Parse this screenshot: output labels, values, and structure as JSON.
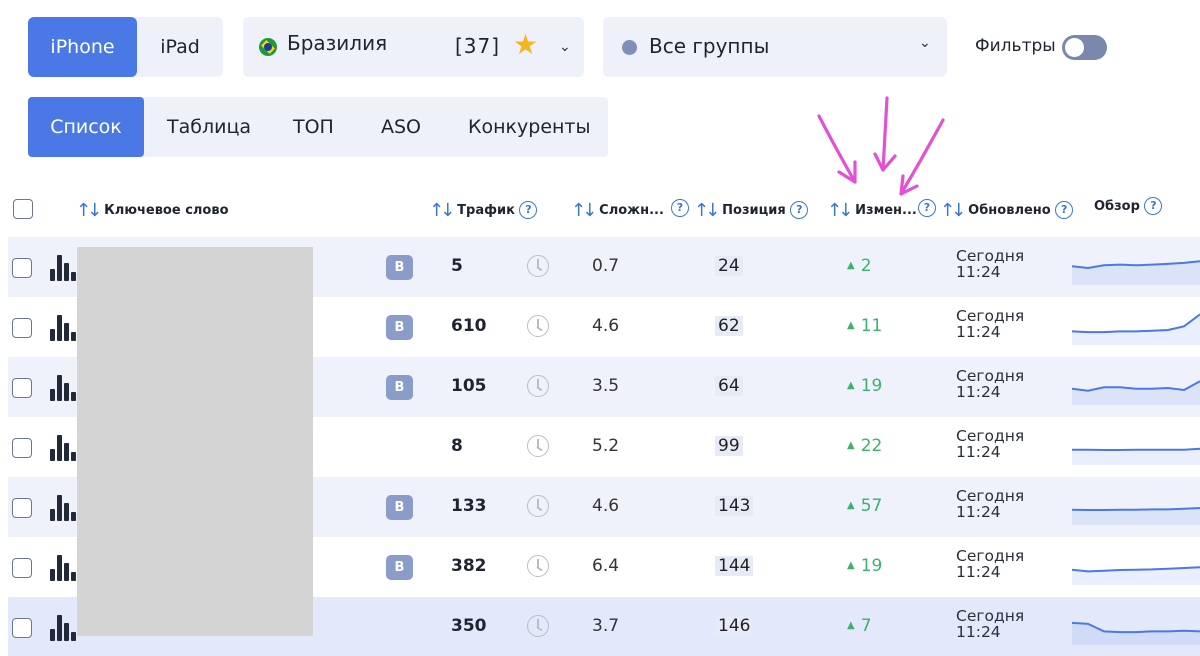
{
  "device_tabs": {
    "iphone": "iPhone",
    "ipad": "iPad",
    "active": "iPhone"
  },
  "country": {
    "name": "Бразилия",
    "count": "[37]"
  },
  "groups": {
    "label": "Все группы"
  },
  "filters": {
    "label": "Фильтры",
    "enabled": false
  },
  "view_tabs": [
    "Список",
    "Таблица",
    "ТОП",
    "ASO",
    "Конкуренты"
  ],
  "view_tab_active": "Список",
  "columns": {
    "keyword": "Ключевое слово",
    "traffic": "Трафик",
    "difficulty": "Сложн...",
    "position": "Позиция",
    "change": "Измен...",
    "updated": "Обновлено",
    "overview": "Обзор"
  },
  "help_glyph": "?",
  "rows": [
    {
      "badge": "B",
      "traffic": "5",
      "difficulty": "0.7",
      "position": "24",
      "change": "2",
      "updated_day": "Сегодня",
      "updated_time": "11:24",
      "trend": [
        0.45,
        0.5,
        0.42,
        0.4,
        0.42,
        0.4,
        0.38,
        0.35,
        0.3
      ]
    },
    {
      "badge": "B",
      "traffic": "610",
      "difficulty": "4.6",
      "position": "62",
      "change": "11",
      "updated_day": "Сегодня",
      "updated_time": "11:24",
      "trend": [
        0.6,
        0.62,
        0.62,
        0.6,
        0.6,
        0.58,
        0.56,
        0.45,
        0.1
      ]
    },
    {
      "badge": "B",
      "traffic": "105",
      "difficulty": "3.5",
      "position": "64",
      "change": "19",
      "updated_day": "Сегодня",
      "updated_time": "11:24",
      "trend": [
        0.52,
        0.58,
        0.48,
        0.48,
        0.52,
        0.52,
        0.5,
        0.56,
        0.3
      ]
    },
    {
      "badge": "",
      "traffic": "8",
      "difficulty": "5.2",
      "position": "99",
      "change": "22",
      "updated_day": "Сегодня",
      "updated_time": "11:24",
      "trend": [
        0.55,
        0.55,
        0.56,
        0.56,
        0.55,
        0.55,
        0.55,
        0.55,
        0.52
      ]
    },
    {
      "badge": "B",
      "traffic": "133",
      "difficulty": "4.6",
      "position": "143",
      "change": "57",
      "updated_day": "Сегодня",
      "updated_time": "11:24",
      "trend": [
        0.55,
        0.56,
        0.56,
        0.55,
        0.55,
        0.54,
        0.54,
        0.52,
        0.5
      ]
    },
    {
      "badge": "B",
      "traffic": "382",
      "difficulty": "6.4",
      "position": "144",
      "change": "19",
      "updated_day": "Сегодня",
      "updated_time": "11:24",
      "trend": [
        0.55,
        0.6,
        0.58,
        0.56,
        0.55,
        0.54,
        0.52,
        0.5,
        0.48
      ]
    },
    {
      "badge": "",
      "traffic": "350",
      "difficulty": "3.7",
      "position": "146",
      "change": "7",
      "updated_day": "Сегодня",
      "updated_time": "11:24",
      "trend": [
        0.35,
        0.38,
        0.6,
        0.62,
        0.62,
        0.6,
        0.6,
        0.58,
        0.6
      ]
    }
  ],
  "colors": {
    "accent": "#4a79e6",
    "change_up": "#3bb36b",
    "sparkline": "#4a79e6",
    "annotation": "#e44fd8"
  }
}
